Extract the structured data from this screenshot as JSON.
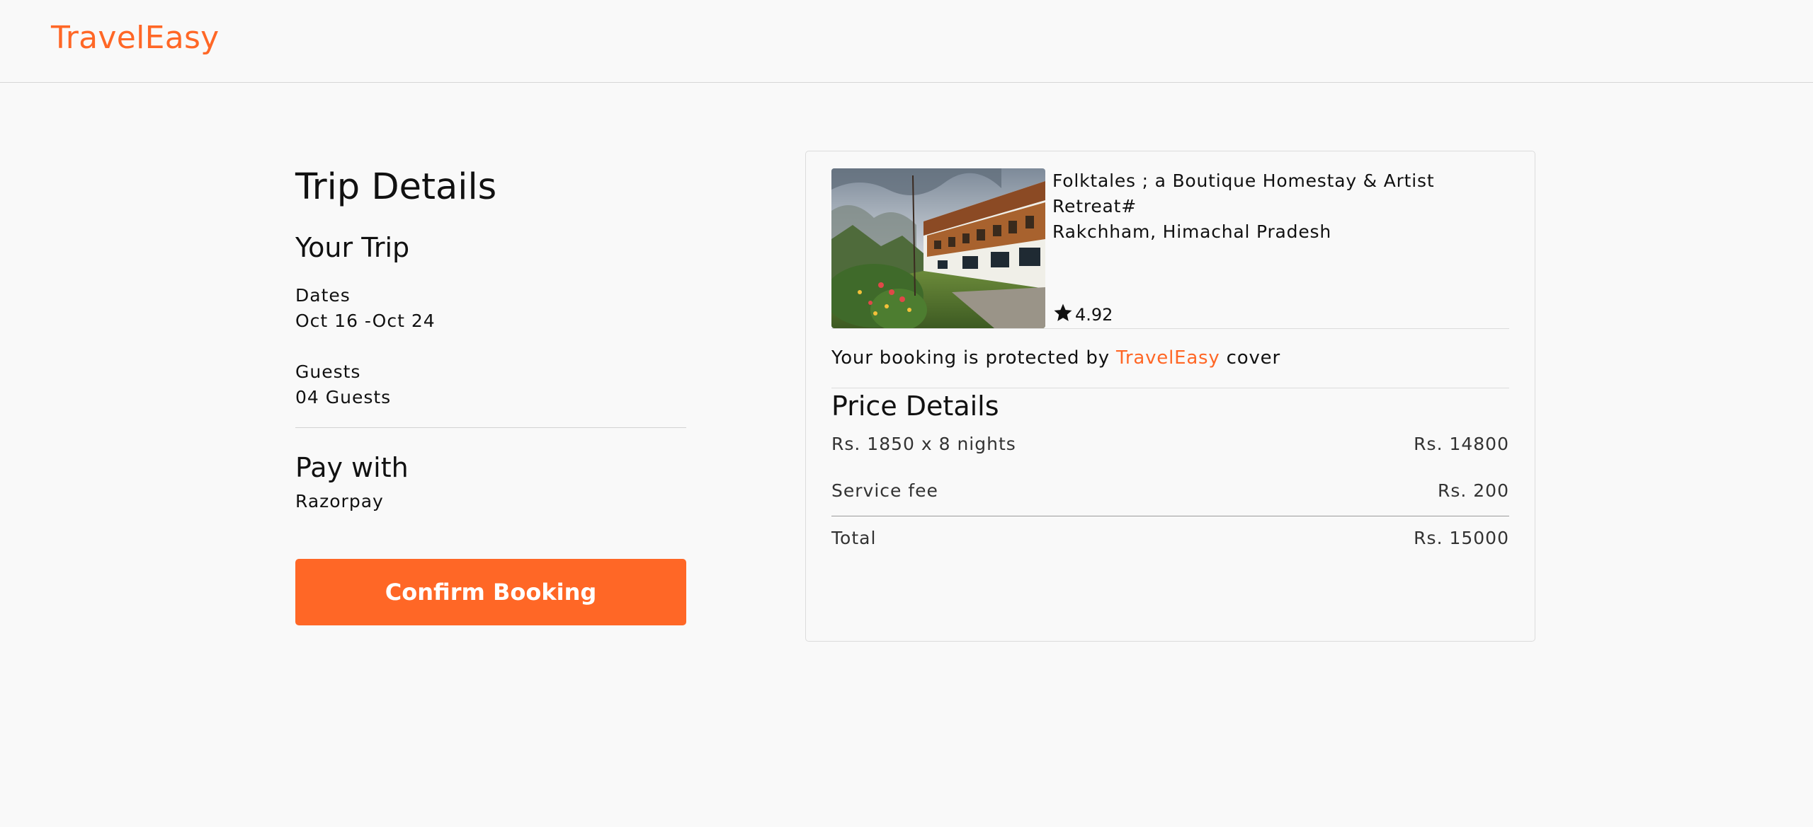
{
  "header": {
    "logo": "TravelEasy"
  },
  "trip": {
    "title": "Trip Details",
    "your_trip_heading": "Your Trip",
    "dates_label": "Dates",
    "dates_value": "Oct 16 -Oct 24",
    "guests_label": "Guests",
    "guests_value": "04 Guests",
    "pay_heading": "Pay with",
    "pay_method": "Razorpay",
    "confirm_label": "Confirm Booking"
  },
  "listing": {
    "name": "Folktales ; a Boutique Homestay & Artist Retreat#",
    "location": "Rakchham, Himachal Pradesh",
    "rating": "4.92",
    "protect_prefix": "Your booking is protected by",
    "protect_brand": "TravelEasy",
    "protect_suffix": "cover"
  },
  "price": {
    "title": "Price Details",
    "rows": [
      {
        "label": "Rs. 1850 x 8 nights",
        "value": "Rs. 14800"
      },
      {
        "label": "Service fee",
        "value": "Rs. 200"
      },
      {
        "label": "Total",
        "value": "Rs. 15000"
      }
    ]
  },
  "colors": {
    "accent": "#ff6726",
    "background": "#f9f9f9"
  },
  "icons": {
    "rating": "star-icon"
  }
}
